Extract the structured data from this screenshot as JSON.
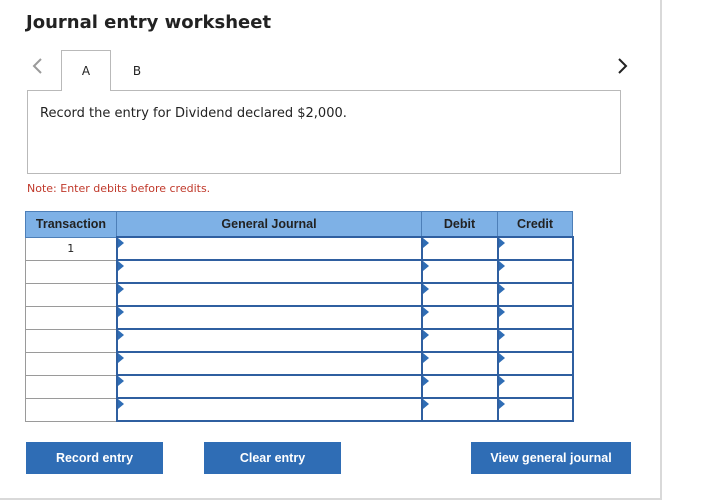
{
  "header": {
    "title": "Journal entry worksheet"
  },
  "tabs": [
    {
      "label": "A",
      "active": true
    },
    {
      "label": "B",
      "active": false
    }
  ],
  "icons": {
    "prev": "chevron-left-icon",
    "next": "chevron-right-icon",
    "dropdown_marker": "triangle-right-icon"
  },
  "prompt": {
    "text": "Record the entry for Dividend declared $2,000."
  },
  "note": {
    "text": "Note: Enter debits before credits."
  },
  "table": {
    "headers": {
      "transaction": "Transaction",
      "general_journal": "General Journal",
      "debit": "Debit",
      "credit": "Credit"
    },
    "rows": [
      {
        "transaction": "1",
        "account": "",
        "debit": "",
        "credit": ""
      },
      {
        "transaction": "",
        "account": "",
        "debit": "",
        "credit": ""
      },
      {
        "transaction": "",
        "account": "",
        "debit": "",
        "credit": ""
      },
      {
        "transaction": "",
        "account": "",
        "debit": "",
        "credit": ""
      },
      {
        "transaction": "",
        "account": "",
        "debit": "",
        "credit": ""
      },
      {
        "transaction": "",
        "account": "",
        "debit": "",
        "credit": ""
      },
      {
        "transaction": "",
        "account": "",
        "debit": "",
        "credit": ""
      },
      {
        "transaction": "",
        "account": "",
        "debit": "",
        "credit": ""
      }
    ]
  },
  "buttons": {
    "record": "Record entry",
    "clear": "Clear entry",
    "view": "View general journal"
  },
  "colors": {
    "header_bg": "#7eb1e6",
    "button_bg": "#2f6db5",
    "note_text": "#c0392b",
    "input_border": "#2f5fa0"
  }
}
